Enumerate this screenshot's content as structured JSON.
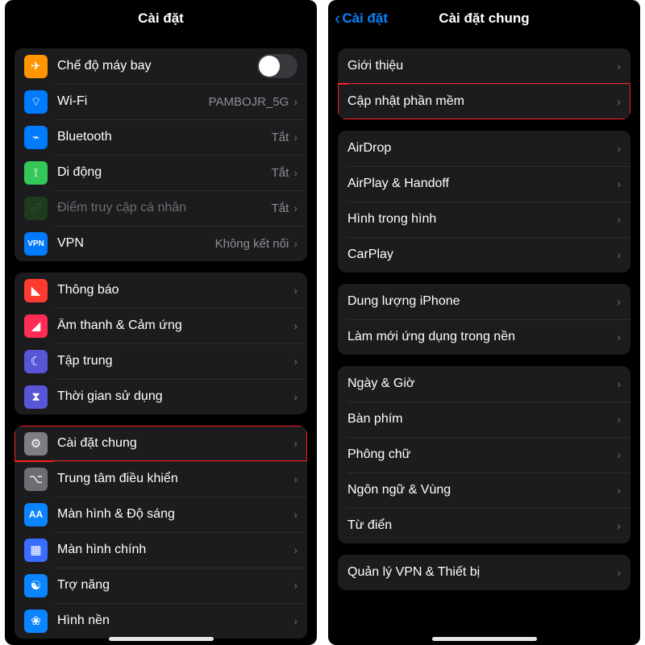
{
  "left": {
    "title": "Cài đặt",
    "group1": [
      {
        "name": "airplane",
        "label": "Chế độ máy bay",
        "type": "toggle"
      },
      {
        "name": "wifi",
        "label": "Wi-Fi",
        "value": "PAMBOJR_5G"
      },
      {
        "name": "bluetooth",
        "label": "Bluetooth",
        "value": "Tắt"
      },
      {
        "name": "cellular",
        "label": "Di động",
        "value": "Tắt"
      },
      {
        "name": "hotspot",
        "label": "Điểm truy cập cá nhân",
        "value": "Tắt",
        "dim": true
      },
      {
        "name": "vpn",
        "label": "VPN",
        "value": "Không kết nối"
      }
    ],
    "group2": [
      {
        "name": "notifications",
        "label": "Thông báo"
      },
      {
        "name": "sounds",
        "label": "Âm thanh & Cảm ứng"
      },
      {
        "name": "focus",
        "label": "Tập trung"
      },
      {
        "name": "screentime",
        "label": "Thời gian sử dụng"
      }
    ],
    "group3": [
      {
        "name": "general",
        "label": "Cài đặt chung",
        "highlight": true
      },
      {
        "name": "controlcenter",
        "label": "Trung tâm điều khiển"
      },
      {
        "name": "display",
        "label": "Màn hình & Độ sáng"
      },
      {
        "name": "homescreen",
        "label": "Màn hình chính"
      },
      {
        "name": "accessibility",
        "label": "Trợ năng"
      },
      {
        "name": "wallpaper",
        "label": "Hình nền"
      }
    ]
  },
  "right": {
    "back": "Cài đặt",
    "title": "Cài đặt chung",
    "group1": [
      {
        "name": "about",
        "label": "Giới thiệu"
      },
      {
        "name": "softwareupdate",
        "label": "Cập nhật phần mềm",
        "highlight": true
      }
    ],
    "group2": [
      {
        "name": "airdrop",
        "label": "AirDrop"
      },
      {
        "name": "airplay",
        "label": "AirPlay & Handoff"
      },
      {
        "name": "pip",
        "label": "Hình trong hình"
      },
      {
        "name": "carplay",
        "label": "CarPlay"
      }
    ],
    "group3": [
      {
        "name": "storage",
        "label": "Dung lượng iPhone"
      },
      {
        "name": "bgrefresh",
        "label": "Làm mới ứng dụng trong nền"
      }
    ],
    "group4": [
      {
        "name": "datetime",
        "label": "Ngày & Giờ"
      },
      {
        "name": "keyboard",
        "label": "Bàn phím"
      },
      {
        "name": "fonts",
        "label": "Phông chữ"
      },
      {
        "name": "language",
        "label": "Ngôn ngữ & Vùng"
      },
      {
        "name": "dictionary",
        "label": "Từ điển"
      }
    ],
    "group5": [
      {
        "name": "vpnmgmt",
        "label": "Quản lý VPN & Thiết bị"
      }
    ]
  }
}
